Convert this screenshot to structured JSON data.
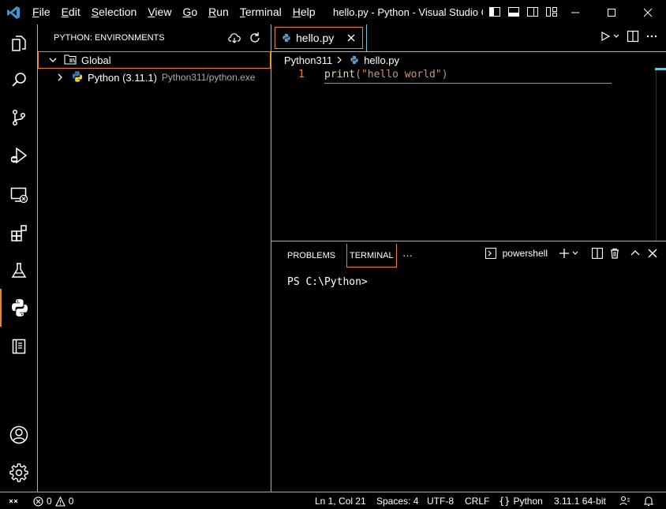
{
  "titlebar": {
    "menu": [
      {
        "mn": "F",
        "rest": "ile"
      },
      {
        "mn": "E",
        "rest": "dit"
      },
      {
        "mn": "S",
        "rest": "election"
      },
      {
        "mn": "V",
        "rest": "iew"
      },
      {
        "mn": "G",
        "rest": "o"
      },
      {
        "mn": "R",
        "rest": "un"
      },
      {
        "mn": "T",
        "rest": "erminal"
      },
      {
        "mn": "H",
        "rest": "elp"
      }
    ],
    "window_title": "hello.py - Python - Visual Studio C..."
  },
  "sidebar": {
    "title": "PYTHON: ENVIRONMENTS",
    "group_label": "Global",
    "env_name": "Python (3.11.1)",
    "env_path": "Python311/python.exe"
  },
  "editor": {
    "tab_label": "hello.py",
    "breadcrumb": [
      "Python311",
      "hello.py"
    ],
    "line_number": "1",
    "code_fn": "print",
    "code_args": "(\"hello world\")"
  },
  "panel": {
    "tab_problems": "PROBLEMS",
    "tab_terminal": "TERMINAL",
    "more": "···",
    "shell_name": "powershell",
    "prompt": "PS C:\\Python>"
  },
  "statusbar": {
    "errors": "0",
    "warnings": "0",
    "position": "Ln 1, Col 21",
    "spaces": "Spaces: 4",
    "encoding": "UTF-8",
    "eol": "CRLF",
    "language": "Python",
    "interpreter": "3.11.1 64-bit"
  },
  "colors": {
    "accent_border": "#f38518",
    "contrast_border": "#6fc3df",
    "vscode_blue": "#3c99d4"
  }
}
